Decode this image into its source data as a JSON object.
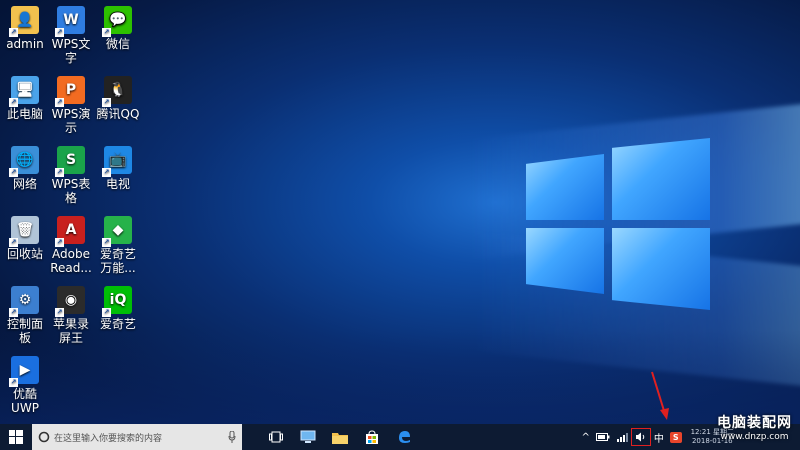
{
  "desktop": {
    "icons": [
      {
        "label": "admin",
        "icon": "user-folder-icon",
        "color": "#f2c14e"
      },
      {
        "label": "WPS文字",
        "icon": "wps-writer-icon",
        "color": "#2f7de1"
      },
      {
        "label": "微信",
        "icon": "wechat-icon",
        "color": "#2dc100"
      },
      {
        "label": "此电脑",
        "icon": "computer-icon",
        "color": "#4aa3ea"
      },
      {
        "label": "WPS演示",
        "icon": "wps-presentation-icon",
        "color": "#f26b21"
      },
      {
        "label": "腾讯QQ",
        "icon": "qq-penguin-icon",
        "color": "#222222"
      },
      {
        "label": "网络",
        "icon": "network-icon",
        "color": "#3a8fd8"
      },
      {
        "label": "WPS表格",
        "icon": "wps-spreadsheet-icon",
        "color": "#1aa34a"
      },
      {
        "label": "电视",
        "icon": "tv-icon",
        "color": "#1e88e5"
      },
      {
        "label": "回收站",
        "icon": "recycle-bin-icon",
        "color": "#b0c4d8"
      },
      {
        "label": "Adobe Read...",
        "icon": "adobe-reader-icon",
        "color": "#c8201e"
      },
      {
        "label": "爱奇艺万能...",
        "icon": "iqiyi-converter-icon",
        "color": "#26b24a"
      },
      {
        "label": "控制面板",
        "icon": "control-panel-icon",
        "color": "#3c7fd0"
      },
      {
        "label": "苹果录屏王",
        "icon": "screen-recorder-icon",
        "color": "#2b2b2b"
      },
      {
        "label": "爱奇艺",
        "icon": "iqiyi-icon",
        "color": "#00be06"
      },
      {
        "label": "优酷UWP",
        "icon": "youku-icon",
        "color": "#1a6fe0"
      }
    ]
  },
  "taskbar": {
    "search_placeholder": "在这里输入你要搜索的内容",
    "apps": [
      "task-view-icon",
      "computer-app-icon",
      "file-explorer-icon",
      "store-icon",
      "edge-icon"
    ],
    "tray": {
      "up_arrow": "^",
      "battery": "battery-icon",
      "network": "network-signal-icon",
      "volume": "speaker-icon",
      "ime": "中",
      "sogou": "S",
      "time": "12:21 星期二",
      "date": "2018-01-16"
    }
  },
  "watermark": {
    "line1": "电脑装配网",
    "line2": "www.dnzp.com"
  },
  "colors": {
    "taskbar_bg": "#0d1b33",
    "highlight_red": "#e02020"
  }
}
